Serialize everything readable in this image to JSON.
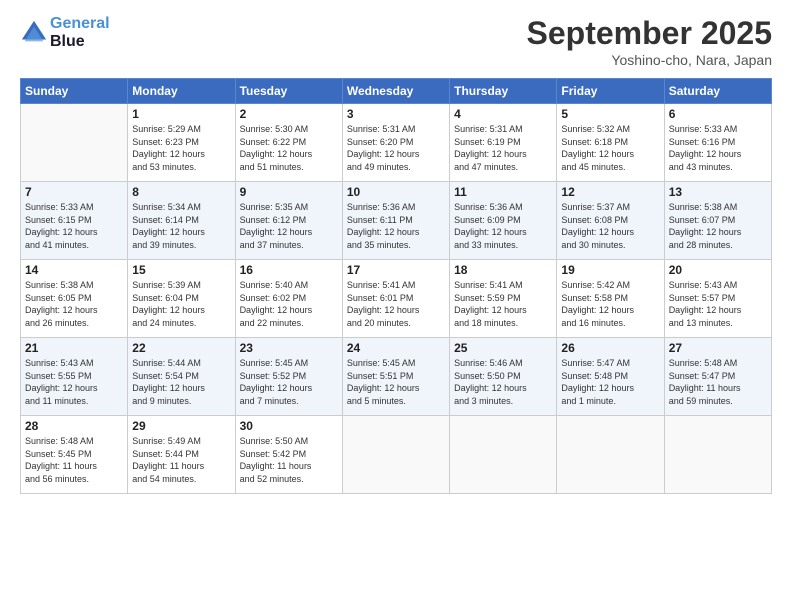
{
  "logo": {
    "line1": "General",
    "line2": "Blue"
  },
  "title": "September 2025",
  "location": "Yoshino-cho, Nara, Japan",
  "weekdays": [
    "Sunday",
    "Monday",
    "Tuesday",
    "Wednesday",
    "Thursday",
    "Friday",
    "Saturday"
  ],
  "weeks": [
    [
      {
        "day": "",
        "info": ""
      },
      {
        "day": "1",
        "info": "Sunrise: 5:29 AM\nSunset: 6:23 PM\nDaylight: 12 hours\nand 53 minutes."
      },
      {
        "day": "2",
        "info": "Sunrise: 5:30 AM\nSunset: 6:22 PM\nDaylight: 12 hours\nand 51 minutes."
      },
      {
        "day": "3",
        "info": "Sunrise: 5:31 AM\nSunset: 6:20 PM\nDaylight: 12 hours\nand 49 minutes."
      },
      {
        "day": "4",
        "info": "Sunrise: 5:31 AM\nSunset: 6:19 PM\nDaylight: 12 hours\nand 47 minutes."
      },
      {
        "day": "5",
        "info": "Sunrise: 5:32 AM\nSunset: 6:18 PM\nDaylight: 12 hours\nand 45 minutes."
      },
      {
        "day": "6",
        "info": "Sunrise: 5:33 AM\nSunset: 6:16 PM\nDaylight: 12 hours\nand 43 minutes."
      }
    ],
    [
      {
        "day": "7",
        "info": "Sunrise: 5:33 AM\nSunset: 6:15 PM\nDaylight: 12 hours\nand 41 minutes."
      },
      {
        "day": "8",
        "info": "Sunrise: 5:34 AM\nSunset: 6:14 PM\nDaylight: 12 hours\nand 39 minutes."
      },
      {
        "day": "9",
        "info": "Sunrise: 5:35 AM\nSunset: 6:12 PM\nDaylight: 12 hours\nand 37 minutes."
      },
      {
        "day": "10",
        "info": "Sunrise: 5:36 AM\nSunset: 6:11 PM\nDaylight: 12 hours\nand 35 minutes."
      },
      {
        "day": "11",
        "info": "Sunrise: 5:36 AM\nSunset: 6:09 PM\nDaylight: 12 hours\nand 33 minutes."
      },
      {
        "day": "12",
        "info": "Sunrise: 5:37 AM\nSunset: 6:08 PM\nDaylight: 12 hours\nand 30 minutes."
      },
      {
        "day": "13",
        "info": "Sunrise: 5:38 AM\nSunset: 6:07 PM\nDaylight: 12 hours\nand 28 minutes."
      }
    ],
    [
      {
        "day": "14",
        "info": "Sunrise: 5:38 AM\nSunset: 6:05 PM\nDaylight: 12 hours\nand 26 minutes."
      },
      {
        "day": "15",
        "info": "Sunrise: 5:39 AM\nSunset: 6:04 PM\nDaylight: 12 hours\nand 24 minutes."
      },
      {
        "day": "16",
        "info": "Sunrise: 5:40 AM\nSunset: 6:02 PM\nDaylight: 12 hours\nand 22 minutes."
      },
      {
        "day": "17",
        "info": "Sunrise: 5:41 AM\nSunset: 6:01 PM\nDaylight: 12 hours\nand 20 minutes."
      },
      {
        "day": "18",
        "info": "Sunrise: 5:41 AM\nSunset: 5:59 PM\nDaylight: 12 hours\nand 18 minutes."
      },
      {
        "day": "19",
        "info": "Sunrise: 5:42 AM\nSunset: 5:58 PM\nDaylight: 12 hours\nand 16 minutes."
      },
      {
        "day": "20",
        "info": "Sunrise: 5:43 AM\nSunset: 5:57 PM\nDaylight: 12 hours\nand 13 minutes."
      }
    ],
    [
      {
        "day": "21",
        "info": "Sunrise: 5:43 AM\nSunset: 5:55 PM\nDaylight: 12 hours\nand 11 minutes."
      },
      {
        "day": "22",
        "info": "Sunrise: 5:44 AM\nSunset: 5:54 PM\nDaylight: 12 hours\nand 9 minutes."
      },
      {
        "day": "23",
        "info": "Sunrise: 5:45 AM\nSunset: 5:52 PM\nDaylight: 12 hours\nand 7 minutes."
      },
      {
        "day": "24",
        "info": "Sunrise: 5:45 AM\nSunset: 5:51 PM\nDaylight: 12 hours\nand 5 minutes."
      },
      {
        "day": "25",
        "info": "Sunrise: 5:46 AM\nSunset: 5:50 PM\nDaylight: 12 hours\nand 3 minutes."
      },
      {
        "day": "26",
        "info": "Sunrise: 5:47 AM\nSunset: 5:48 PM\nDaylight: 12 hours\nand 1 minute."
      },
      {
        "day": "27",
        "info": "Sunrise: 5:48 AM\nSunset: 5:47 PM\nDaylight: 11 hours\nand 59 minutes."
      }
    ],
    [
      {
        "day": "28",
        "info": "Sunrise: 5:48 AM\nSunset: 5:45 PM\nDaylight: 11 hours\nand 56 minutes."
      },
      {
        "day": "29",
        "info": "Sunrise: 5:49 AM\nSunset: 5:44 PM\nDaylight: 11 hours\nand 54 minutes."
      },
      {
        "day": "30",
        "info": "Sunrise: 5:50 AM\nSunset: 5:42 PM\nDaylight: 11 hours\nand 52 minutes."
      },
      {
        "day": "",
        "info": ""
      },
      {
        "day": "",
        "info": ""
      },
      {
        "day": "",
        "info": ""
      },
      {
        "day": "",
        "info": ""
      }
    ]
  ]
}
